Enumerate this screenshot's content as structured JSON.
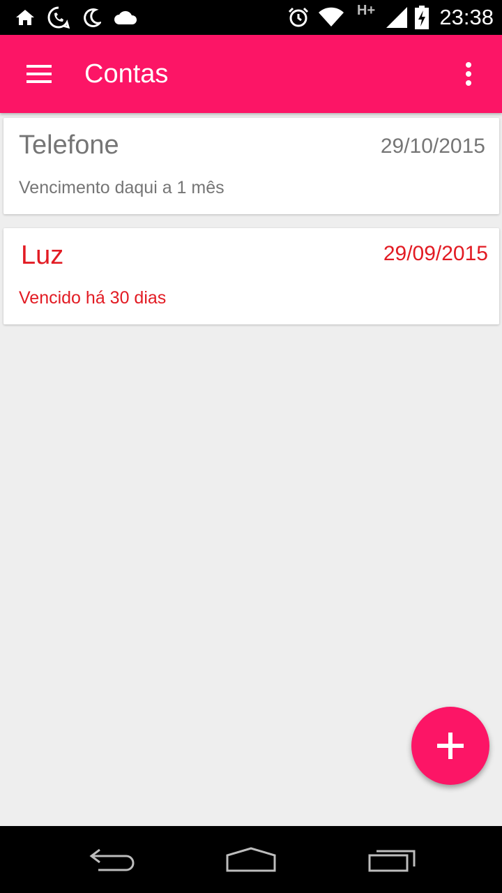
{
  "status_bar": {
    "time": "23:38",
    "network_type": "H+",
    "icons": [
      "home-icon",
      "whatsapp-icon",
      "moon-icon",
      "cloud-icon",
      "alarm-icon",
      "wifi-icon",
      "signal-icon",
      "battery-charging-icon"
    ]
  },
  "app_bar": {
    "title": "Contas",
    "left_icon": "menu-icon",
    "right_icon": "more-vert-icon",
    "color": "#fc1566"
  },
  "bills": [
    {
      "name": "Telefone",
      "date": "29/10/2015",
      "status": "Vencimento daqui a 1 mês",
      "overdue": false,
      "color": "#757575"
    },
    {
      "name": "Luz",
      "date": "29/09/2015",
      "status": "Vencido há 30 dias",
      "overdue": true,
      "color": "#e21b23"
    }
  ],
  "fab": {
    "icon": "plus-icon",
    "color": "#fc1566"
  },
  "nav_bar": {
    "icons": [
      "back-icon",
      "home-nav-icon",
      "recents-icon"
    ]
  }
}
